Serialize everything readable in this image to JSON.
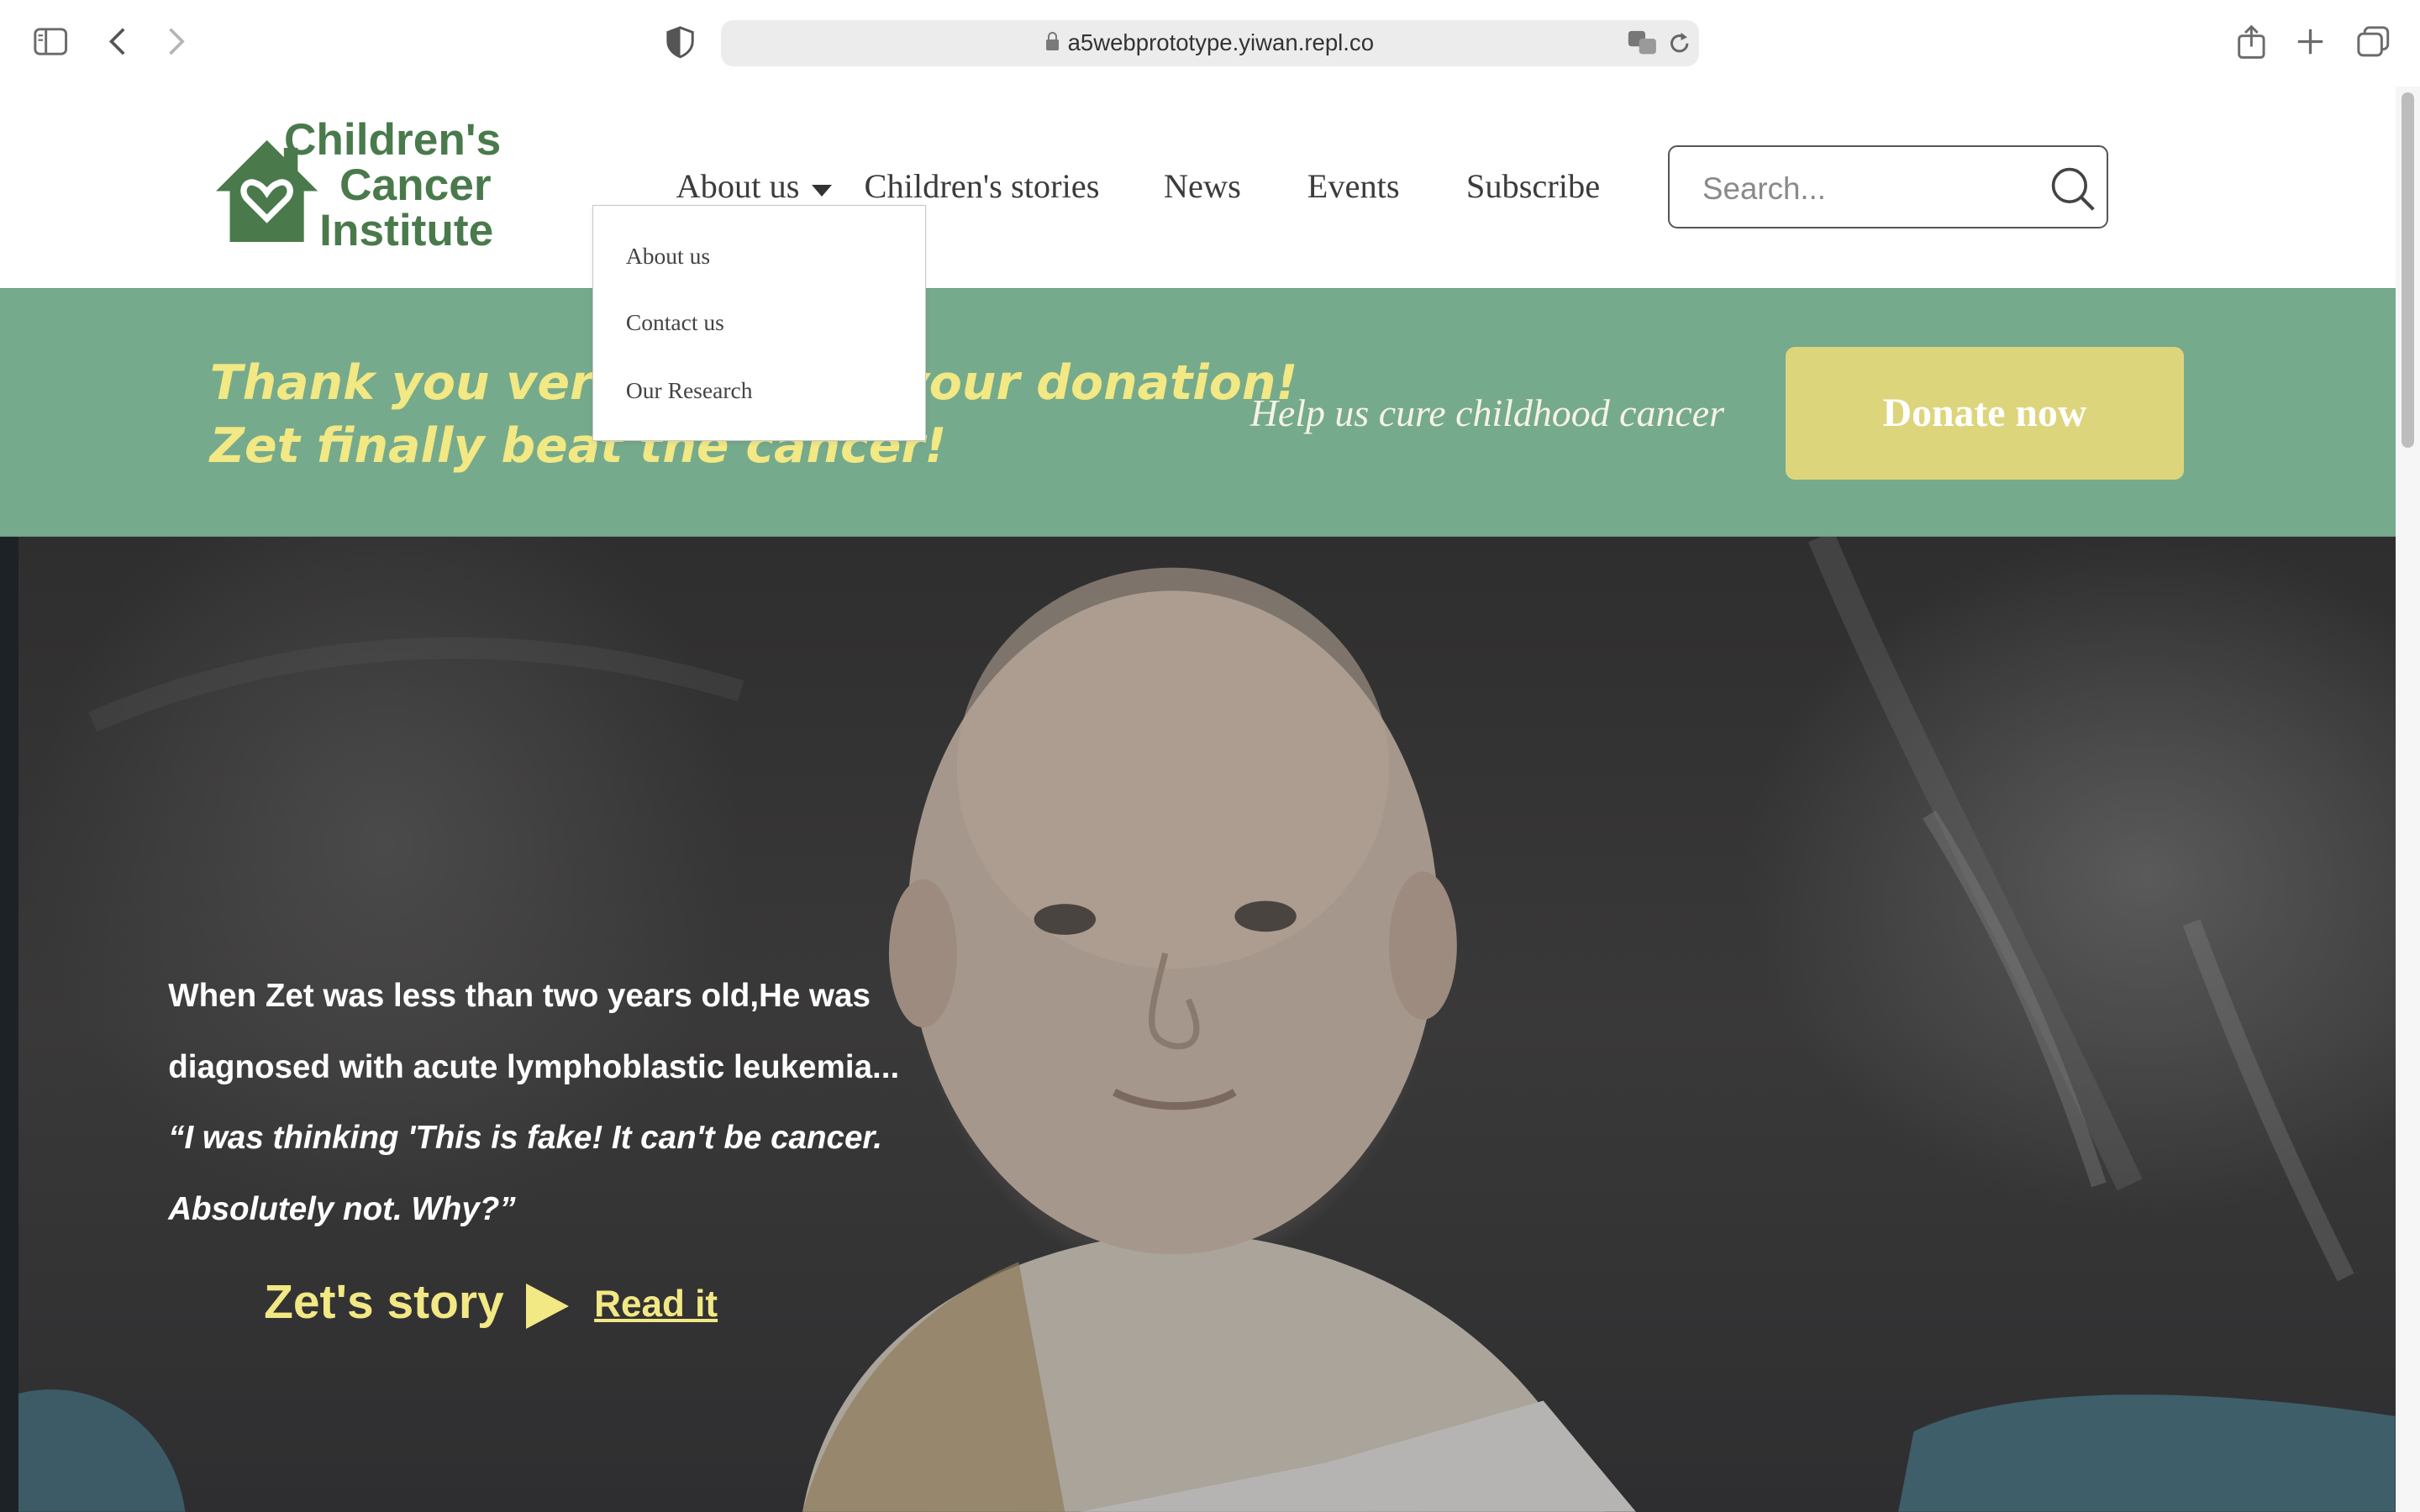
{
  "browser": {
    "url": "a5webprototype.yiwan.repl.co"
  },
  "site": {
    "logo_lines": [
      "Children's",
      "Cancer",
      "Institute"
    ],
    "nav": [
      {
        "label": "About us"
      },
      {
        "label": "Children's stories"
      },
      {
        "label": "News"
      },
      {
        "label": "Events"
      },
      {
        "label": "Subscribe"
      }
    ],
    "search_placeholder": "Search...",
    "dropdown": [
      "About us",
      "Contact us",
      "Our Research"
    ]
  },
  "banner": {
    "thanks_line1": "Thank you very much for your donation!",
    "thanks_line2": "Zet finally beat the cancer!",
    "help_text": "Help us cure childhood cancer",
    "donate_label": "Donate now"
  },
  "hero": {
    "story_line1": "When Zet was less than two years old,He was",
    "story_line2": "diagnosed with acute lymphoblastic leukemia...",
    "quote_line1": "“I was thinking 'This is fake! It can't be cancer.",
    "quote_line2": "Absolutely not. Why?”",
    "story_title": "Zet's story",
    "read_label": "Read it"
  },
  "colors": {
    "brand_green": "#4a7a4c",
    "banner_green": "#76aa8c",
    "accent_yellow": "#f2e884",
    "donate_bg": "#ddd57c"
  }
}
